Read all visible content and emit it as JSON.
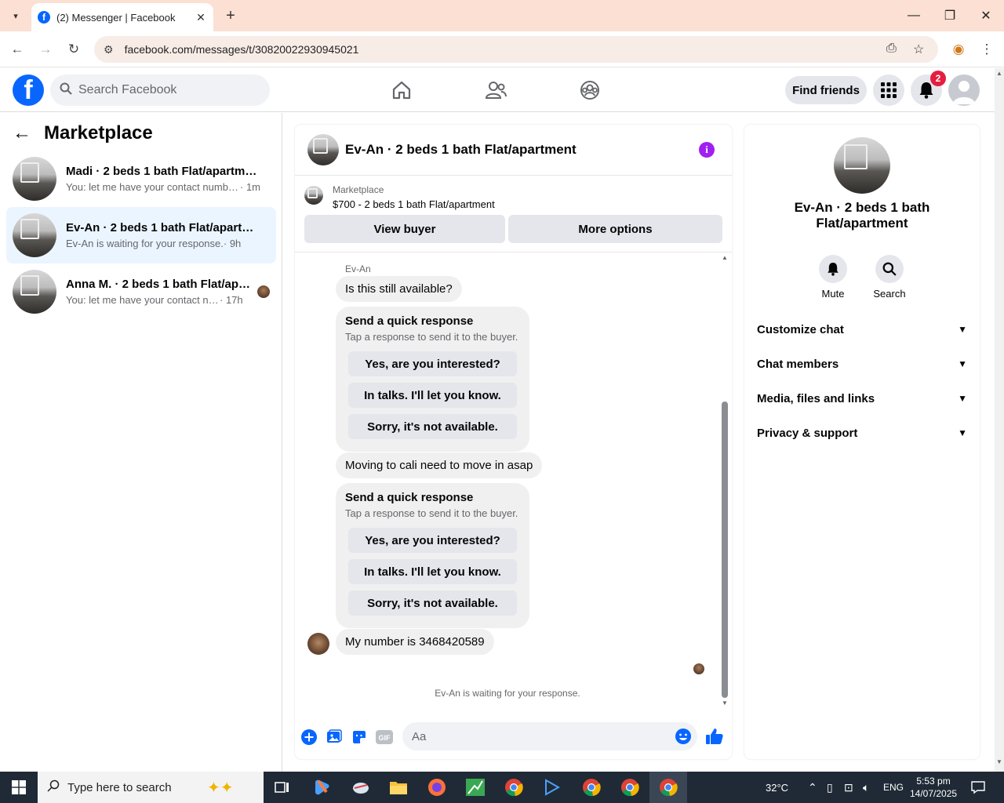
{
  "browser": {
    "tab_title": "(2) Messenger | Facebook",
    "url": "facebook.com/messages/t/30820022930945021"
  },
  "header": {
    "search_placeholder": "Search Facebook",
    "find_friends": "Find friends",
    "notification_count": "2"
  },
  "sidebar": {
    "title": "Marketplace",
    "conversations": [
      {
        "name": "Madi · 2 beds 1 bath Flat/apartment",
        "preview": "You: let me have your contact numbe...",
        "time": " · 1m",
        "selected": false
      },
      {
        "name": "Ev-An · 2 beds 1 bath Flat/apartment",
        "preview": "Ev-An is waiting for your response.",
        "time": " · 9h",
        "selected": true
      },
      {
        "name": "Anna M. · 2 beds 1 bath Flat/apartment",
        "preview": "You: let me have your contact nu...",
        "time": " · 17h",
        "selected": false
      }
    ]
  },
  "chat": {
    "title": "Ev-An · 2 beds 1 bath Flat/apartment",
    "marketplace_label": "Marketplace",
    "listing": "$700 - 2 beds 1 bath Flat/apartment",
    "view_buyer": "View buyer",
    "more_options": "More options",
    "sender": "Ev-An",
    "msg1": "Is this still available?",
    "qr_title": "Send a quick response",
    "qr_sub": "Tap a response to send it to the buyer.",
    "qr_options": [
      "Yes, are you interested?",
      "In talks. I'll let you know.",
      "Sorry, it's not available."
    ],
    "msg2": "Moving to cali need to move in asap",
    "msg3": "My number is 3468420589",
    "waiting": "Ev-An is waiting for your response.",
    "composer_placeholder": "Aa"
  },
  "rpanel": {
    "name": "Ev-An · 2 beds 1 bath Flat/apartment",
    "mute": "Mute",
    "search": "Search",
    "sections": [
      "Customize chat",
      "Chat members",
      "Media, files and links",
      "Privacy & support"
    ]
  },
  "taskbar": {
    "search_placeholder": "Type here to search",
    "temp": "32°C",
    "lang": "ENG",
    "time": "5:53 pm",
    "date": "14/07/2025"
  },
  "colors": {
    "fb_blue": "#0866ff",
    "badge_red": "#e41e3f",
    "info_purple": "#a020f0",
    "tab_bg": "#fbe0d3"
  }
}
